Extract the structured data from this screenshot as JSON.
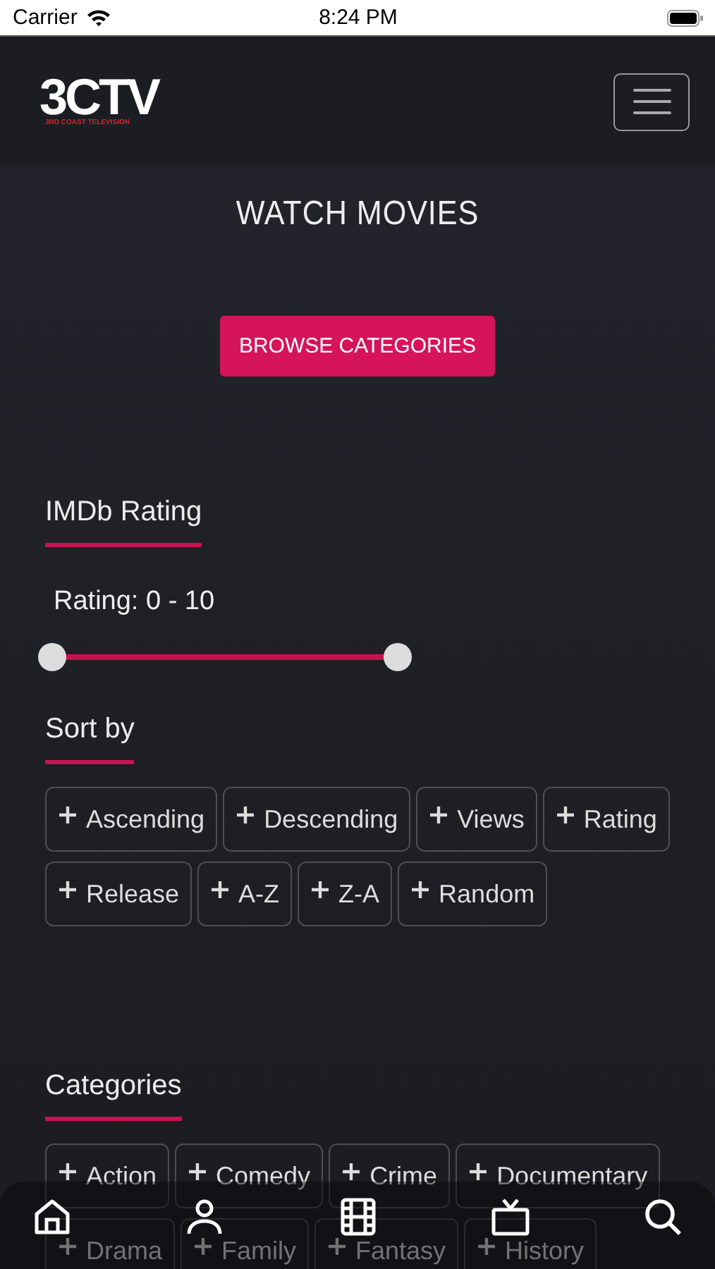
{
  "status_bar": {
    "carrier": "Carrier",
    "time": "8:24 PM"
  },
  "header": {
    "logo": {
      "text": "3CTV",
      "tagline": "3RD COAST TELEVISION"
    }
  },
  "title": "WATCH MOVIES",
  "browse_button": "BROWSE CATEGORIES",
  "rating": {
    "heading": "IMDb Rating",
    "reading": "Rating: 0 - 10",
    "thumbs": [
      {
        "level": 0
      },
      {
        "level": 1
      }
    ]
  },
  "sort": {
    "heading": "Sort by",
    "options": [
      {
        "label": "Ascending",
        "selected": false
      },
      {
        "label": "Descending",
        "selected": false
      },
      {
        "label": "Views",
        "selected": false
      },
      {
        "label": "Rating",
        "selected": false
      },
      {
        "label": "Release",
        "selected": false
      },
      {
        "label": "A-Z",
        "selected": false
      },
      {
        "label": "Z-A",
        "selected": false
      },
      {
        "label": "Random",
        "selected": false
      }
    ]
  },
  "categories": {
    "heading": "Categories",
    "options": [
      {
        "label": "Action",
        "selected": false
      },
      {
        "label": "Comedy",
        "selected": false
      },
      {
        "label": "Crime",
        "selected": false
      },
      {
        "label": "Documentary",
        "selected": false
      },
      {
        "label": "Drama",
        "selected": false
      },
      {
        "label": "Family",
        "selected": false
      },
      {
        "label": "Fantasy",
        "selected": false
      },
      {
        "label": "History",
        "selected": false
      }
    ]
  },
  "tab_bar": [
    {
      "kind": "home"
    },
    {
      "kind": "profile"
    },
    {
      "kind": "movies"
    },
    {
      "kind": "tv"
    },
    {
      "kind": "search"
    }
  ]
}
